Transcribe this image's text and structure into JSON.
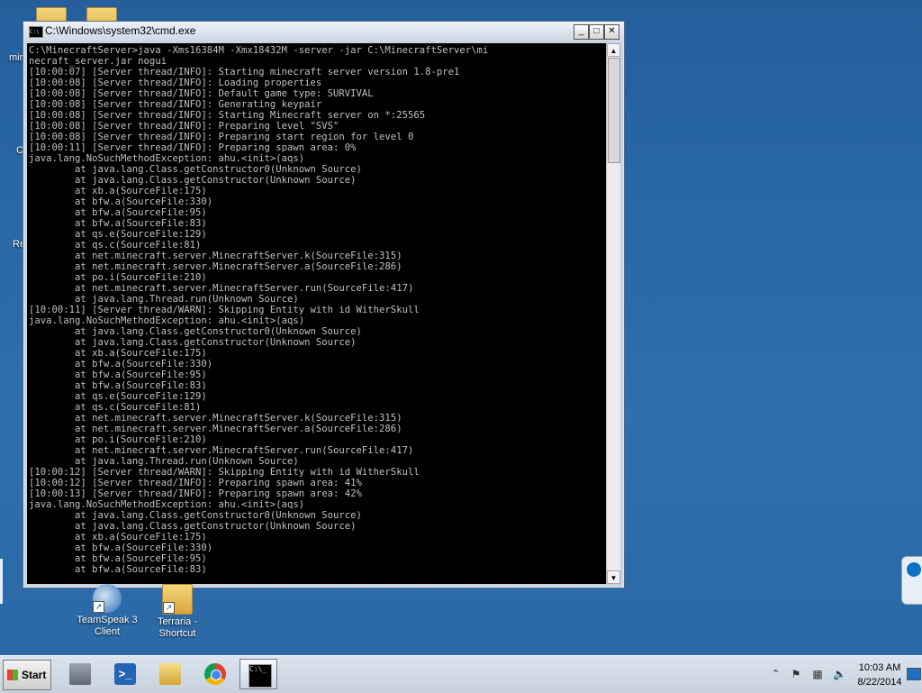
{
  "desktop": {
    "icons": [
      {
        "label": "TeamSpeak 3\nClient"
      },
      {
        "label": "Terraria -\nShortcut"
      }
    ],
    "partial_labels": [
      "mir",
      "C",
      "Re"
    ]
  },
  "cmd_window": {
    "title": "C:\\Windows\\system32\\cmd.exe",
    "min_label": "_",
    "max_label": "□",
    "close_label": "✕",
    "console_lines": [
      "C:\\MinecraftServer>java -Xms16384M -Xmx18432M -server -jar C:\\MinecraftServer\\mi",
      "necraft_server.jar nogui",
      "[10:00:07] [Server thread/INFO]: Starting minecraft server version 1.8-pre1",
      "[10:00:08] [Server thread/INFO]: Loading properties",
      "[10:00:08] [Server thread/INFO]: Default game type: SURVIVAL",
      "[10:00:08] [Server thread/INFO]: Generating keypair",
      "[10:00:08] [Server thread/INFO]: Starting Minecraft server on *:25565",
      "[10:00:08] [Server thread/INFO]: Preparing level \"SVS\"",
      "[10:00:08] [Server thread/INFO]: Preparing start region for level 0",
      "[10:00:11] [Server thread/INFO]: Preparing spawn area: 0%",
      "java.lang.NoSuchMethodException: ahu.<init>(aqs)",
      "        at java.lang.Class.getConstructor0(Unknown Source)",
      "        at java.lang.Class.getConstructor(Unknown Source)",
      "        at xb.a(SourceFile:175)",
      "        at bfw.a(SourceFile:330)",
      "        at bfw.a(SourceFile:95)",
      "        at bfw.a(SourceFile:83)",
      "        at qs.e(SourceFile:129)",
      "        at qs.c(SourceFile:81)",
      "        at net.minecraft.server.MinecraftServer.k(SourceFile:315)",
      "        at net.minecraft.server.MinecraftServer.a(SourceFile:286)",
      "        at po.i(SourceFile:210)",
      "        at net.minecraft.server.MinecraftServer.run(SourceFile:417)",
      "        at java.lang.Thread.run(Unknown Source)",
      "[10:00:11] [Server thread/WARN]: Skipping Entity with id WitherSkull",
      "java.lang.NoSuchMethodException: ahu.<init>(aqs)",
      "        at java.lang.Class.getConstructor0(Unknown Source)",
      "        at java.lang.Class.getConstructor(Unknown Source)",
      "        at xb.a(SourceFile:175)",
      "        at bfw.a(SourceFile:330)",
      "        at bfw.a(SourceFile:95)",
      "        at bfw.a(SourceFile:83)",
      "        at qs.e(SourceFile:129)",
      "        at qs.c(SourceFile:81)",
      "        at net.minecraft.server.MinecraftServer.k(SourceFile:315)",
      "        at net.minecraft.server.MinecraftServer.a(SourceFile:286)",
      "        at po.i(SourceFile:210)",
      "        at net.minecraft.server.MinecraftServer.run(SourceFile:417)",
      "        at java.lang.Thread.run(Unknown Source)",
      "[10:00:12] [Server thread/WARN]: Skipping Entity with id WitherSkull",
      "[10:00:12] [Server thread/INFO]: Preparing spawn area: 41%",
      "[10:00:13] [Server thread/INFO]: Preparing spawn area: 42%",
      "java.lang.NoSuchMethodException: ahu.<init>(aqs)",
      "        at java.lang.Class.getConstructor0(Unknown Source)",
      "        at java.lang.Class.getConstructor(Unknown Source)",
      "        at xb.a(SourceFile:175)",
      "        at bfw.a(SourceFile:330)",
      "        at bfw.a(SourceFile:95)",
      "        at bfw.a(SourceFile:83)"
    ]
  },
  "taskbar": {
    "start_label": "Start",
    "cmd_icon_text": "C:\\_",
    "ps_icon_text": ">_",
    "clock_time": "10:03 AM",
    "clock_date": "8/22/2014"
  }
}
